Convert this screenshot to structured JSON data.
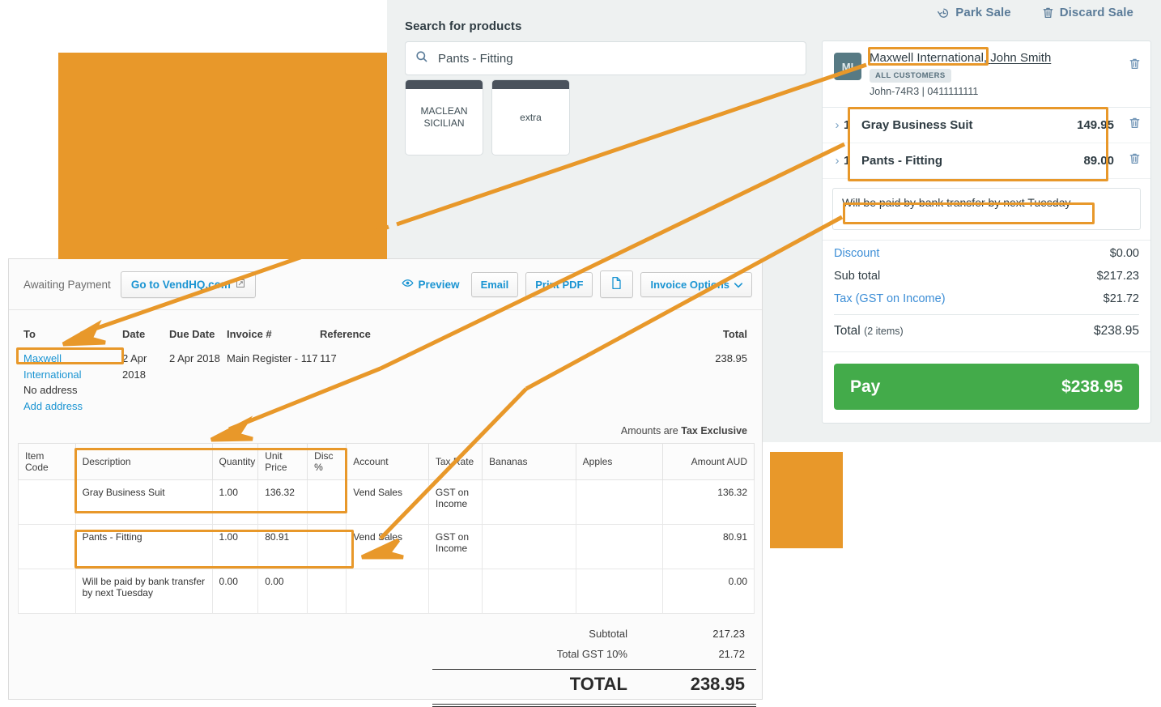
{
  "colors": {
    "annotation_orange": "#e8982a",
    "pos_background": "#eef1f1",
    "pay_green": "#43ab4a",
    "link_blue": "#3d8ed6",
    "xero_blue": "#1a94d2",
    "avatar_teal": "#577a84"
  },
  "pos": {
    "topbar": {
      "park_sale": "Park Sale",
      "discard_sale": "Discard Sale",
      "park_icon": "history-clock-icon",
      "discard_icon": "trash-icon"
    },
    "search": {
      "label": "Search for products",
      "value": "Pants - Fitting",
      "placeholder": "Search for products",
      "icon": "search-icon"
    },
    "tiles": [
      {
        "name": "MACLEAN SICILIAN"
      },
      {
        "name": "extra"
      }
    ],
    "cart": {
      "customer": {
        "avatar_initials": "MI",
        "company": "Maxwell International",
        "separator": ", ",
        "person": "John Smith",
        "group_badge": "ALL CUSTOMERS",
        "meta": "John-74R3 | 0411111111",
        "delete_icon": "trash-icon"
      },
      "line_items": [
        {
          "expand_icon": "chevron-right-icon",
          "qty": "1",
          "name": "Gray Business Suit",
          "price": "149.95",
          "delete_icon": "trash-icon"
        },
        {
          "expand_icon": "chevron-right-icon",
          "qty": "1",
          "name": "Pants - Fitting",
          "price": "89.00",
          "delete_icon": "trash-icon"
        }
      ],
      "note": "Will be paid by bank transfer by next Tuesday",
      "totals": [
        {
          "label": "Discount",
          "value": "$0.00",
          "link": true
        },
        {
          "label": "Sub total",
          "value": "$217.23",
          "link": false
        },
        {
          "label": "Tax (GST on Income)",
          "value": "$21.72",
          "link": true
        }
      ],
      "grand": {
        "label": "Total",
        "sub": "(2 items)",
        "value": "$238.95"
      },
      "pay": {
        "label": "Pay",
        "amount": "$238.95"
      }
    }
  },
  "invoice": {
    "toolbar": {
      "status": "Awaiting Payment",
      "vend_link": "Go to VendHQ.com",
      "vend_icon": "external-link-icon",
      "preview": "Preview",
      "preview_icon": "eye-icon",
      "email": "Email",
      "print_pdf": "Print PDF",
      "attach_icon": "file-page-icon",
      "invoice_options": "Invoice Options",
      "options_caret": "chevron-down-icon"
    },
    "header": {
      "to_label": "To",
      "to_value": "Maxwell International",
      "no_address": "No address",
      "add_address": "Add address",
      "date_label": "Date",
      "date_value": "2 Apr 2018",
      "due_label": "Due Date",
      "due_value": "2 Apr 2018",
      "invoice_label": "Invoice #",
      "invoice_value": "Main Register - 117",
      "reference_label": "Reference",
      "reference_value": "117",
      "total_label": "Total",
      "total_value": "238.95"
    },
    "tax_note_prefix": "Amounts are ",
    "tax_note_bold": "Tax Exclusive",
    "table": {
      "columns": [
        "Item Code",
        "Description",
        "Quantity",
        "Unit Price",
        "Disc %",
        "Account",
        "Tax Rate",
        "Bananas",
        "Apples",
        "Amount AUD"
      ],
      "rows": [
        {
          "item_code": "",
          "description": "Gray Business Suit",
          "quantity": "1.00",
          "unit_price": "136.32",
          "disc": "",
          "account": "Vend Sales",
          "tax_rate": "GST on Income",
          "bananas": "",
          "apples": "",
          "amount": "136.32"
        },
        {
          "item_code": "",
          "description": "Pants - Fitting",
          "quantity": "1.00",
          "unit_price": "80.91",
          "disc": "",
          "account": "Vend Sales",
          "tax_rate": "GST on Income",
          "bananas": "",
          "apples": "",
          "amount": "80.91"
        },
        {
          "item_code": "",
          "description": "Will be paid by bank transfer by next Tuesday",
          "quantity": "0.00",
          "unit_price": "0.00",
          "disc": "",
          "account": "",
          "tax_rate": "",
          "bananas": "",
          "apples": "",
          "amount": "0.00"
        }
      ]
    },
    "totals": {
      "subtotal_label": "Subtotal",
      "subtotal_value": "217.23",
      "gst_label": "Total GST  10%",
      "gst_value": "21.72",
      "total_label": "TOTAL",
      "total_value": "238.95"
    }
  }
}
